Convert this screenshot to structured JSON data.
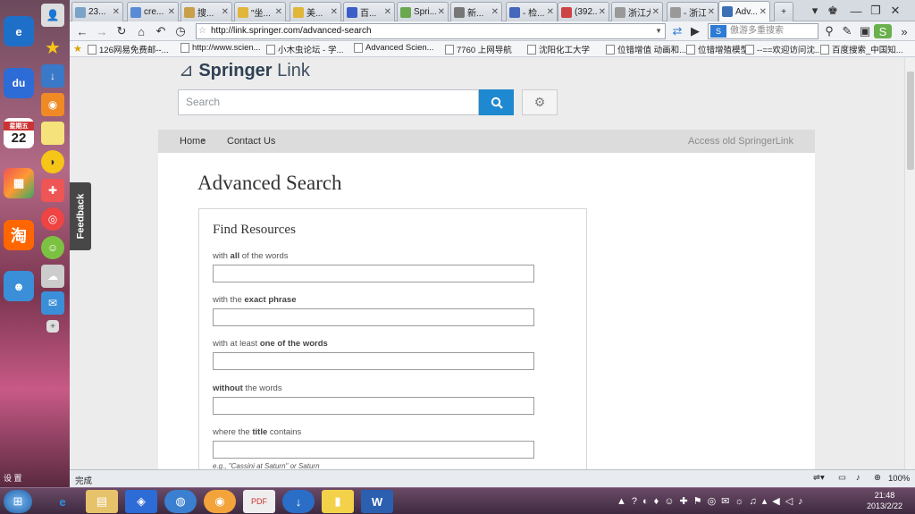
{
  "desktop": {
    "settings_label": "设 置",
    "calendar_weekday": "星期五",
    "calendar_day": "22",
    "taobao_label": "淘",
    "baidu_label": "du"
  },
  "browser": {
    "tabs": [
      {
        "label": "23...",
        "color": "#7aa3c9"
      },
      {
        "label": "cre...",
        "color": "#5a8ad6"
      },
      {
        "label": "搜...",
        "color": "#c9a04a"
      },
      {
        "label": "\"坐...",
        "color": "#e0b63b"
      },
      {
        "label": "美...",
        "color": "#e0b63b"
      },
      {
        "label": "百...",
        "color": "#3a5fc8"
      },
      {
        "label": "Spri...",
        "color": "#6aa84f"
      },
      {
        "label": "新...",
        "color": "#777777"
      },
      {
        "label": "- 检...",
        "color": "#4466bb"
      },
      {
        "label": "(392...",
        "color": "#cc4444"
      },
      {
        "label": "浙江大...",
        "color": "#999999"
      },
      {
        "label": "- 浙江...",
        "color": "#999999"
      },
      {
        "label": "Adv...",
        "color": "#3d6fb5"
      }
    ],
    "new_tab_label": "+",
    "url": "http://link.springer.com/advanced-search",
    "search_placeholder": "傲游多重搜索",
    "favorites": [
      "126网易免费邮--...",
      "http://www.scien...",
      "小木虫论坛 - 学...",
      "Advanced Scien...",
      "7760 上网导航",
      "沈阳化工大学",
      "位错增值 动画和...",
      "位错增殖模型",
      "--==欢迎访问沈...",
      "百度搜索_中国知..."
    ],
    "status_text": "完成",
    "zoom": "100%",
    "feedback_label": "Feedback"
  },
  "page": {
    "logo_mark": "⊿",
    "logo_springer": "Springer",
    "logo_link": "Link",
    "search_placeholder": "Search",
    "nav": {
      "home": "Home",
      "separator": "•",
      "contact": "Contact Us",
      "old_link": "Access old SpringerLink"
    },
    "title": "Advanced Search",
    "panel_title": "Find Resources",
    "fields": [
      {
        "pre": "with ",
        "bold": "all",
        "post": " of the words"
      },
      {
        "pre": "with the ",
        "bold": "exact phrase",
        "post": ""
      },
      {
        "pre": "with at least ",
        "bold": "one of the words",
        "post": ""
      },
      {
        "pre": "",
        "bold": "without",
        "post": " the words"
      },
      {
        "pre": "where the ",
        "bold": "title",
        "post": " contains"
      }
    ],
    "example": "e.g., \"Cassini at Saturn\" or Saturn"
  },
  "taskbar": {
    "time": "21:48",
    "date": "2013/2/22"
  }
}
